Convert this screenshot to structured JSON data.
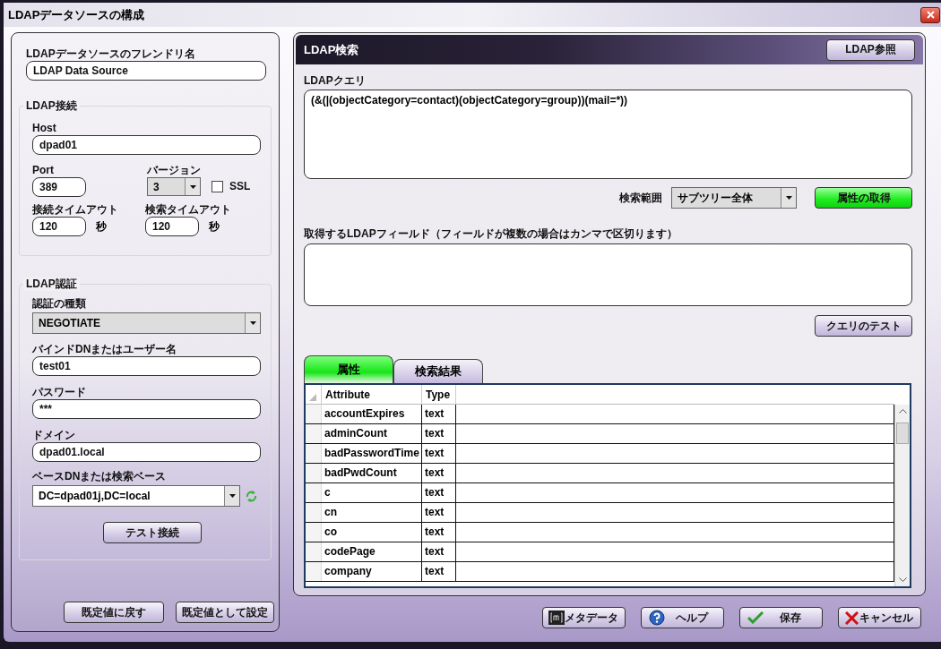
{
  "window": {
    "title": "LDAPデータソースの構成"
  },
  "friendly_name": {
    "label": "LDAPデータソースのフレンドリ名",
    "value": "LDAP Data Source"
  },
  "connection": {
    "legend": "LDAP接続",
    "host": {
      "label": "Host",
      "value": "dpad01"
    },
    "port": {
      "label": "Port",
      "value": "389"
    },
    "version": {
      "label": "バージョン",
      "value": "3"
    },
    "ssl": {
      "label": "SSL",
      "checked": false
    },
    "connect_timeout": {
      "label": "接続タイムアウト",
      "value": "120",
      "unit": "秒"
    },
    "search_timeout": {
      "label": "検索タイムアウト",
      "value": "120",
      "unit": "秒"
    }
  },
  "authentication": {
    "legend": "LDAP認証",
    "auth_type": {
      "label": "認証の種類",
      "value": "NEGOTIATE"
    },
    "bind_dn": {
      "label": "バインドDNまたはユーザー名",
      "value": "test01"
    },
    "password": {
      "label": "パスワード",
      "value": "***"
    },
    "domain": {
      "label": "ドメイン",
      "value": "dpad01.local"
    },
    "base_dn": {
      "label": "ベースDNまたは検索ベース",
      "value": "DC=dpad01j,DC=local"
    },
    "test_button": "テスト接続"
  },
  "left_buttons": [
    "既定値に戻す",
    "既定値として設定"
  ],
  "search": {
    "title": "LDAP検索",
    "browse_button": "LDAP参照",
    "query": {
      "label": "LDAPクエリ",
      "value": "(&(|(objectCategory=contact)(objectCategory=group))(mail=*))"
    },
    "scope": {
      "label": "検索範囲",
      "value": "サブツリー全体"
    },
    "get_attributes_button": "属性の取得",
    "fields": {
      "label": "取得するLDAPフィールド（フィールドが複数の場合はカンマで区切ります）"
    },
    "test_query_button": "クエリのテスト",
    "tabs": [
      {
        "label": "属性",
        "selected": true
      },
      {
        "label": "検索結果",
        "selected": false
      }
    ],
    "table": {
      "columns": [
        "Attribute",
        "Type"
      ],
      "rows": [
        [
          "accountExpires",
          "text"
        ],
        [
          "adminCount",
          "text"
        ],
        [
          "badPasswordTime",
          "text"
        ],
        [
          "badPwdCount",
          "text"
        ],
        [
          "c",
          "text"
        ],
        [
          "cn",
          "text"
        ],
        [
          "co",
          "text"
        ],
        [
          "codePage",
          "text"
        ],
        [
          "company",
          "text"
        ]
      ]
    }
  },
  "footer_buttons": [
    {
      "kind": "metadata",
      "label": "メタデータ"
    },
    {
      "kind": "help",
      "label": "ヘルプ"
    },
    {
      "kind": "save",
      "label": "保存"
    },
    {
      "kind": "cancel",
      "label": "キャンセル"
    }
  ]
}
